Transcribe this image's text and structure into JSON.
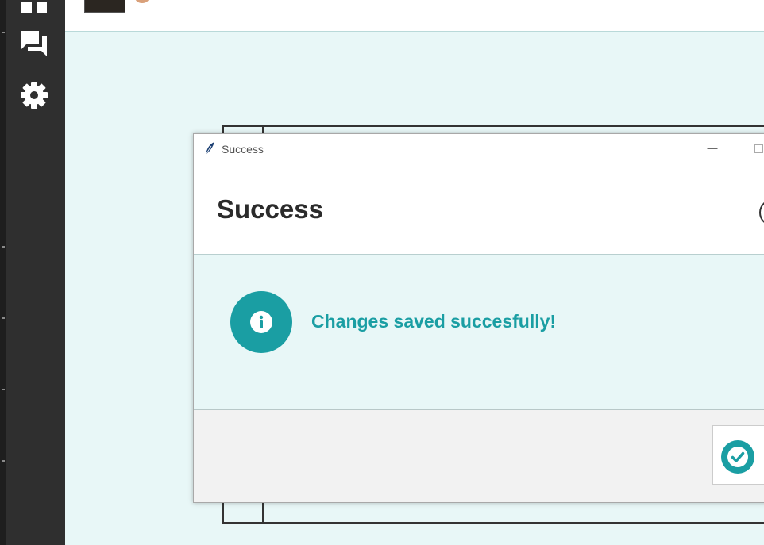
{
  "window": {
    "title": "Success"
  },
  "dialog": {
    "heading": "Success",
    "message": "Changes saved succesfully!",
    "icon": "info-icon",
    "confirm_icon": "check-circle-icon"
  },
  "sidebar": {
    "items": [
      {
        "icon": "grid-icon"
      },
      {
        "icon": "chat-icon"
      },
      {
        "icon": "gear-icon"
      }
    ]
  },
  "colors": {
    "accent": "#1a9ea3",
    "sidebar": "#2f2f2f",
    "content_bg": "#e8f7f7"
  }
}
